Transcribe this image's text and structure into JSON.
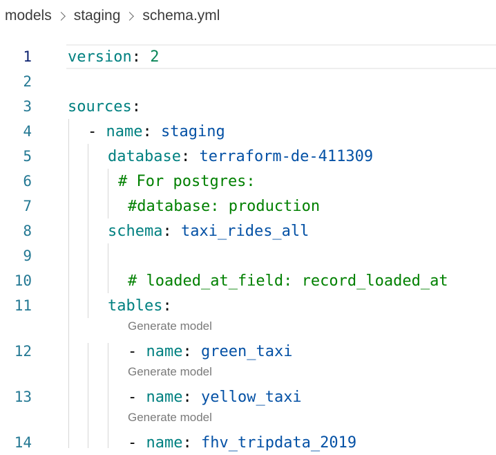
{
  "breadcrumb": [
    "models",
    "staging",
    "schema.yml"
  ],
  "lines": [
    {
      "num": "1"
    },
    {
      "num": "2"
    },
    {
      "num": "3"
    },
    {
      "num": "4"
    },
    {
      "num": "5"
    },
    {
      "num": "6"
    },
    {
      "num": "7"
    },
    {
      "num": "8"
    },
    {
      "num": "9"
    },
    {
      "num": "10"
    },
    {
      "num": "11"
    },
    {
      "num": "12"
    },
    {
      "num": "13"
    },
    {
      "num": "14"
    }
  ],
  "tokens": {
    "l1": [
      "version",
      ":",
      " ",
      "2"
    ],
    "l3": [
      "sources",
      ":"
    ],
    "l4": [
      "- ",
      "name",
      ":",
      " ",
      "staging"
    ],
    "l5": [
      "database",
      ":",
      " ",
      "terraform-de-411309"
    ],
    "l6": "# For postgres:",
    "l7": "#database: production",
    "l8": [
      "schema",
      ":",
      " ",
      "taxi_rides_all"
    ],
    "l10": "# loaded_at_field: record_loaded_at",
    "l11": [
      "tables",
      ":"
    ],
    "l12": [
      "- ",
      "name",
      ":",
      " ",
      "green_taxi"
    ],
    "l13": [
      "- ",
      "name",
      ":",
      " ",
      "yellow_taxi"
    ],
    "l14": [
      "- ",
      "name",
      ":",
      " ",
      "fhv_tripdata_2019"
    ]
  },
  "code_lens": {
    "generate_model": "Generate model"
  },
  "colors": {
    "key": "#008080",
    "string": "#0451a5",
    "number": "#098658",
    "comment": "#008000",
    "line_number": "#237893",
    "active_line_number": "#0b216f"
  }
}
